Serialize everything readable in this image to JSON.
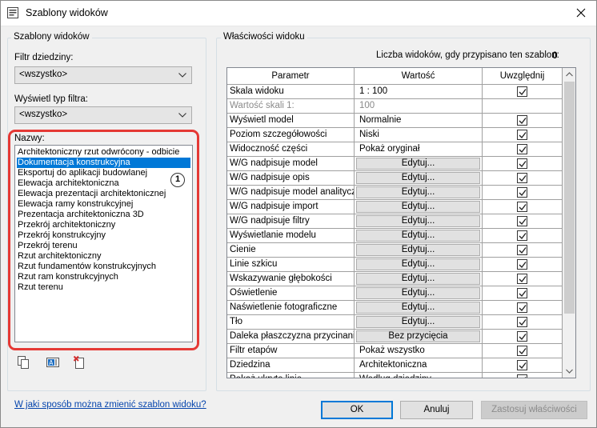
{
  "window": {
    "title": "Szablony widoków",
    "icon": "revit-app-icon"
  },
  "left_panel": {
    "group_label": "Szablony widoków",
    "discipline_filter_label": "Filtr dziedziny:",
    "discipline_filter_value": "<wszystko>",
    "view_type_label": "Wyświetl typ filtra:",
    "view_type_value": "<wszystko>",
    "names_label": "Nazwy:",
    "names": [
      "Architektoniczny rzut odwrócony - odbicie",
      "Dokumentacja konstrukcyjna",
      "Eksportuj do aplikacji budowlanej",
      "Elewacja architektoniczna",
      "Elewacja prezentacji architektonicznej",
      "Elewacja ramy konstrukcyjnej",
      "Prezentacja architektoniczna 3D",
      "Przekrój architektoniczny",
      "Przekrój konstrukcyjny",
      "Przekrój terenu",
      "Rzut architektoniczny",
      "Rzut fundamentów konstrukcyjnych",
      "Rzut ram konstrukcyjnych",
      "Rzut terenu"
    ],
    "selected_index": 1,
    "callout": "1",
    "tools": [
      "duplicate-icon",
      "rename-icon",
      "delete-icon"
    ]
  },
  "right_panel": {
    "group_label": "Właściwości widoku",
    "count_label": "Liczba widoków, gdy przypisano ten szablon:",
    "count_value": "0",
    "columns": [
      "Parametr",
      "Wartość",
      "Uwzględnij"
    ],
    "rows": [
      {
        "param": "Skala widoku",
        "value": "1 : 100",
        "type": "text",
        "include": true
      },
      {
        "param": "Wartość skali   1:",
        "value": "100",
        "type": "text",
        "include": null,
        "disabled": true
      },
      {
        "param": "Wyświetl model",
        "value": "Normalnie",
        "type": "text",
        "include": true
      },
      {
        "param": "Poziom szczegółowości",
        "value": "Niski",
        "type": "text",
        "include": true
      },
      {
        "param": "Widoczność części",
        "value": "Pokaż oryginał",
        "type": "text",
        "include": true
      },
      {
        "param": "W/G nadpisuje model",
        "value": "Edytuj...",
        "type": "button",
        "include": true
      },
      {
        "param": "W/G nadpisuje opis",
        "value": "Edytuj...",
        "type": "button",
        "include": true
      },
      {
        "param": "W/G nadpisuje model analityczny",
        "value": "Edytuj...",
        "type": "button",
        "include": true
      },
      {
        "param": "W/G nadpisuje import",
        "value": "Edytuj...",
        "type": "button",
        "include": true
      },
      {
        "param": "W/G nadpisuje filtry",
        "value": "Edytuj...",
        "type": "button",
        "include": true
      },
      {
        "param": "Wyświetlanie modelu",
        "value": "Edytuj...",
        "type": "button",
        "include": true
      },
      {
        "param": "Cienie",
        "value": "Edytuj...",
        "type": "button",
        "include": true
      },
      {
        "param": "Linie szkicu",
        "value": "Edytuj...",
        "type": "button",
        "include": true
      },
      {
        "param": "Wskazywanie głębokości",
        "value": "Edytuj...",
        "type": "button",
        "include": true
      },
      {
        "param": "Oświetlenie",
        "value": "Edytuj...",
        "type": "button",
        "include": true
      },
      {
        "param": "Naświetlenie fotograficzne",
        "value": "Edytuj...",
        "type": "button",
        "include": true
      },
      {
        "param": "Tło",
        "value": "Edytuj...",
        "type": "button",
        "include": true
      },
      {
        "param": "Daleka płaszczyzna przycinania",
        "value": "Bez przycięcia",
        "type": "button",
        "include": true
      },
      {
        "param": "Filtr etapów",
        "value": "Pokaż wszystko",
        "type": "text",
        "include": true
      },
      {
        "param": "Dziedzina",
        "value": "Architektoniczna",
        "type": "text",
        "include": true
      },
      {
        "param": "Pokaż ukryte linie",
        "value": "Według dziedziny",
        "type": "text",
        "include": true
      }
    ]
  },
  "footer": {
    "help_link": "W jaki sposób można zmienić szablon widoku?",
    "ok_label": "OK",
    "cancel_label": "Anuluj",
    "apply_label": "Zastosuj właściwości"
  },
  "colors": {
    "highlight": "#e53935",
    "selection": "#0078d7",
    "link": "#0645ad"
  }
}
